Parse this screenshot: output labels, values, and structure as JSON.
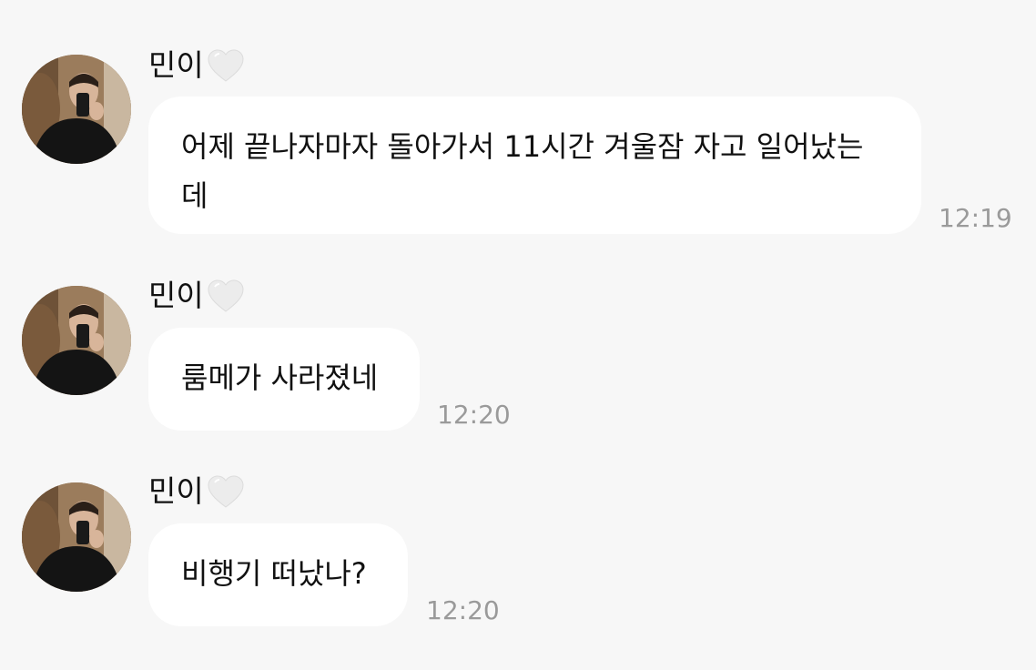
{
  "messages": [
    {
      "sender": "민이",
      "heart_icon": "white-heart-icon",
      "text": "어제 끝나자마자 돌아가서 11시간 겨울잠 자고 일어났는데",
      "time": "12:19"
    },
    {
      "sender": "민이",
      "heart_icon": "white-heart-icon",
      "text": "룸메가 사라졌네",
      "time": "12:20"
    },
    {
      "sender": "민이",
      "heart_icon": "white-heart-icon",
      "text": "비행기 떠났나?",
      "time": "12:20"
    }
  ],
  "colors": {
    "background": "#f7f7f7",
    "bubble": "#ffffff",
    "time": "#9a9a9a",
    "heart": "#ececec"
  }
}
